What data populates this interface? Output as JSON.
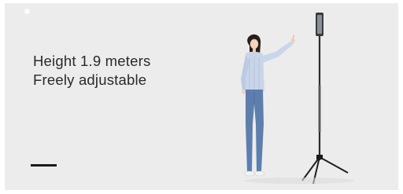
{
  "caption": {
    "line1": "Height 1.9 meters",
    "line2": "Freely adjustable"
  },
  "colors": {
    "background": "#ececec",
    "text": "#2a2a2a",
    "shirt": "#c9d6ea",
    "jeans": "#5d7fae",
    "tripod": "#222222"
  },
  "icons": [
    "tripod-selfie-stick-image",
    "woman-figure-image"
  ]
}
